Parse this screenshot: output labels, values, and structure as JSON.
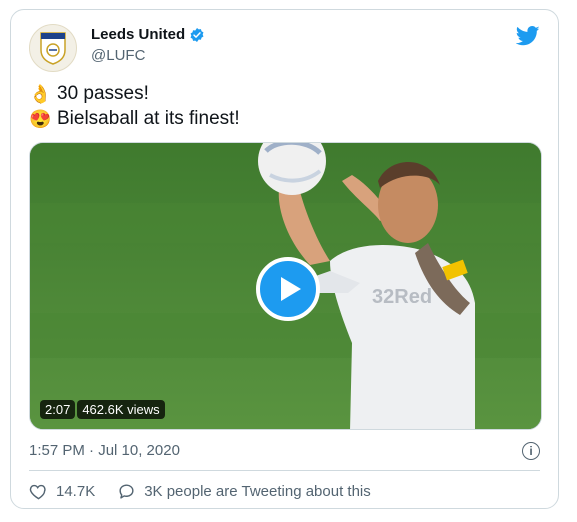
{
  "account": {
    "display_name": "Leeds United",
    "handle": "@LUFC",
    "avatar_icon": "leeds-crest-icon",
    "verified_icon": "verified-badge-icon"
  },
  "brand": {
    "accent": "#1d9bf0",
    "logo_icon": "twitter-bird-icon"
  },
  "tweet": {
    "lines": [
      {
        "emoji": "👌",
        "emoji_name": "ok-hand-icon",
        "text": "30 passes!"
      },
      {
        "emoji": "😍",
        "emoji_name": "heart-eyes-icon",
        "text": "Bielsaball at its finest!"
      }
    ]
  },
  "video": {
    "duration": "2:07",
    "views": "462.6K views",
    "play_icon": "play-icon"
  },
  "timestamp": "1:57 PM · Jul 10, 2020",
  "actions": {
    "likes": "14.7K",
    "conversation": "3K people are Tweeting about this"
  }
}
